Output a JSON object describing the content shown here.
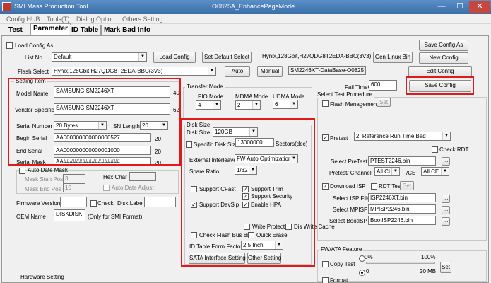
{
  "window": {
    "app_title": "SMI Mass Production Tool",
    "doc_title": "O0825A_EnhancePageMode",
    "minimize": "—",
    "maximize": "☐",
    "close": "✕"
  },
  "menu": [
    "Config HUB",
    "Tools(T)",
    "Dialog Option",
    "Others Setting"
  ],
  "tabs": [
    "Test",
    "Parameter",
    "ID Table",
    "Mark Bad Info"
  ],
  "top": {
    "load_config_as": "Load Config As",
    "list_no_label": "List No.",
    "list_no_value": "Default",
    "load_config": "Load Config",
    "set_default_select": "Set Default Select",
    "flash_info": "Hynix,128Gbit,H27QDG8T2EDA-BBC(3V3)",
    "gen_linux_bin": "Gen Linux Bin",
    "save_config_as": "Save Config As",
    "new_config": "New Config",
    "edit_config": "Edit Config",
    "save_config": "Save Config",
    "flash_select_label": "Flash Select",
    "flash_select_value": "Hynix,128Gbit,H27QDG8T2EDA-BBC(3V3)",
    "auto": "Auto",
    "manual": "Manual",
    "database": "SM2246XT-DataBase-O0825"
  },
  "setting_item": {
    "title": "Setting Item",
    "model_name_label": "Model Name",
    "model_name_value": "SAMSUNG SM2246XT",
    "model_name_len": "40",
    "vendor_specific_label": "Vendor Specific",
    "vendor_specific_value": "SAMSUNG SM2246XT",
    "vendor_specific_len": "62",
    "serial_number_label": "Serial Number",
    "serial_number_value": "20 Bytes",
    "sn_length_label": "SN Length",
    "sn_length_value": "20",
    "begin_serial_label": "Begin Serial",
    "begin_serial_value": "AA000000000000000527",
    "begin_serial_len": "20",
    "end_serial_label": "End Serial",
    "end_serial_value": "AA000000000000001000",
    "end_serial_len": "20",
    "serial_mask_label": "Serial Mask",
    "serial_mask_value": "AA##################",
    "serial_mask_len": "20"
  },
  "auto_date": {
    "auto_date_mask": "Auto Date Mask",
    "mask_start_pos": "Mask Start Pos",
    "mask_start_value": "3",
    "mask_end_pos": "Mask End Pos",
    "mask_end_value": "10",
    "hex_char": "Hex Char",
    "auto_date_adjust": "Auto Date Adjust"
  },
  "firmware": {
    "firmware_version": "Firmware Version",
    "check": "Check",
    "disk_label": "Disk Label",
    "oem_name_label": "OEM Name",
    "oem_name_value": "DISKDISK",
    "oem_note": "(Only for SMI Format)"
  },
  "hardware_setting": "Hardware Setting",
  "transfer_mode": {
    "title": "Transfer Mode",
    "pio": "PIO Mode",
    "pio_value": "4",
    "mdma": "MDMA Mode",
    "mdma_value": "2",
    "udma": "UDMA Mode",
    "udma_value": "6"
  },
  "disk_size": {
    "title": "Disk Size",
    "disk_size_label": "Disk Size",
    "disk_size_value": "120GB",
    "specific_disk_size": "Specific Disk Size",
    "specific_value": "13000000",
    "sectors": "Sectors(dec)",
    "external_interleave": "External Interleave",
    "external_value": "FW Auto Optimization",
    "spare_ratio": "Spare Ratio",
    "spare_value": "1/32",
    "support_cfast": "Support CFast",
    "support_trim": "Support Trim",
    "support_security": "Support Security",
    "support_devslp": "Support DevSlp",
    "enable_hpa": "Enable HPA",
    "write_protect": "Write Protect",
    "dis_write_cache": "Dis Write Cache",
    "check_flash_bus_bit": "Check Flash Bus Bit",
    "quick_erase": "Quick Erase",
    "id_table_form_factor": "ID Table Form Factor",
    "form_factor_value": "2.5 Inch",
    "sata_interface_setting": "SATA Interface Setting",
    "other_setting": "Other Setting"
  },
  "fail_timeout": {
    "label": "Fail TimeOut",
    "value": "600"
  },
  "select_test": {
    "title": "Select Test Procedure",
    "flash_management": "Flash Management",
    "set": "Set",
    "pretest": "Pretest",
    "pretest_value": "2. Reference Run Time Bad",
    "check_rdt": "Check RDT",
    "select_pretest": "Select PreTest",
    "pretest_file": "PTEST2246.bin",
    "pretest_channel": "Pretest/ Channel",
    "channel_value": "All CH",
    "ce_label": "/CE",
    "ce_value": "All CE",
    "download_isp": "Download ISP",
    "rdt_test": "RDT Test",
    "select_isp_file": "Select ISP File",
    "isp_file": "ISP2246XT.bin",
    "select_mpisp": "Select MPISP",
    "mpisp_file": "MPISP2246.bin",
    "select_bootisp": "Select BootISP",
    "bootisp_file": "BootISP2246.bin",
    "browse": "..."
  },
  "fw_ata": {
    "title": "FW/ATA Feature",
    "copy_test": "Copy Test",
    "pct_zero": "0%",
    "pct_hundred": "100%",
    "mb_zero": "0",
    "mb_twenty": "20 MB",
    "set": "Set",
    "format": "Format"
  },
  "colors": {
    "highlight_red": "#e0191c",
    "title_blue": "#3a6ea8"
  }
}
